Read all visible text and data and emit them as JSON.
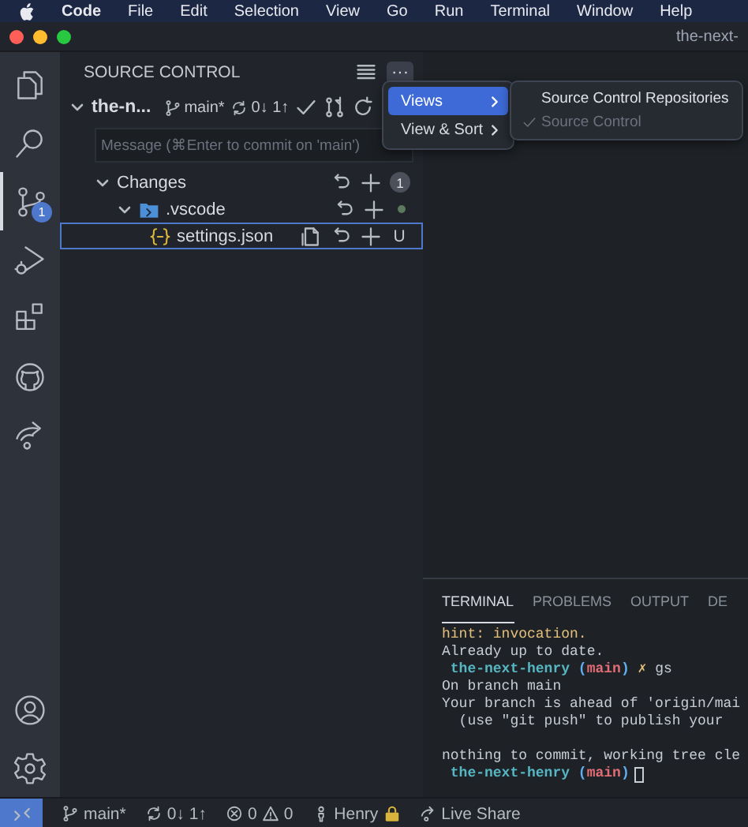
{
  "menu_bar": {
    "items": [
      {
        "label": "Code",
        "kind": "app"
      },
      {
        "label": "File",
        "kind": "menu"
      },
      {
        "label": "Edit",
        "kind": "menu"
      },
      {
        "label": "Selection",
        "kind": "menu"
      },
      {
        "label": "View",
        "kind": "menu"
      },
      {
        "label": "Go",
        "kind": "menu"
      },
      {
        "label": "Run",
        "kind": "menu"
      },
      {
        "label": "Terminal",
        "kind": "menu"
      },
      {
        "label": "Window",
        "kind": "menu"
      },
      {
        "label": "Help",
        "kind": "menu"
      }
    ]
  },
  "window": {
    "title": "the-next-"
  },
  "activity_bar": {
    "items": [
      {
        "kind": "files",
        "selected": false
      },
      {
        "kind": "search",
        "selected": false
      },
      {
        "kind": "source_control",
        "selected": true,
        "badge": "1"
      },
      {
        "kind": "run",
        "selected": false
      },
      {
        "kind": "extensions",
        "selected": false
      },
      {
        "kind": "github",
        "selected": false
      },
      {
        "kind": "live_share",
        "selected": false
      }
    ],
    "bottom_items": [
      {
        "kind": "accounts",
        "selected": false
      },
      {
        "kind": "settings",
        "selected": false
      }
    ]
  },
  "sidebar": {
    "title": "SOURCE CONTROL",
    "more": "···",
    "repository": {
      "name": "the-n...",
      "expanded": true,
      "branch": "main*",
      "sync": "0↓ 1↑"
    },
    "message": {
      "placeholder": "Message (⌘Enter to commit on 'main')"
    },
    "changes": {
      "label": "Changes",
      "count": "1",
      "expanded": true,
      "children": [
        {
          "kind": "folder",
          "name": ".vscode",
          "expanded": true,
          "selected": false,
          "children": [
            {
              "kind": "file",
              "name": "settings.json",
              "status": "U",
              "selected": true
            }
          ]
        }
      ]
    }
  },
  "context_menu": {
    "items": [
      {
        "label": "Views",
        "selected": true
      },
      {
        "label": "View & Sort",
        "selected": false
      }
    ],
    "submenu": {
      "items": [
        {
          "label": "Source Control Repositories",
          "checked": false,
          "disabled": false
        },
        {
          "label": "Source Control",
          "checked": true,
          "disabled": true
        }
      ]
    }
  },
  "panel": {
    "tabs": [
      {
        "label": "TERMINAL",
        "selected": true
      },
      {
        "label": "PROBLEMS",
        "selected": false
      },
      {
        "label": "OUTPUT",
        "selected": false
      },
      {
        "label": "DE",
        "selected": false
      }
    ],
    "lines": [
      {
        "segments": [
          {
            "kind": "hint",
            "text": "hint: invocation."
          }
        ]
      },
      {
        "segments": [
          {
            "kind": "text",
            "text": "Already up to date."
          }
        ]
      },
      {
        "segments": [
          {
            "kind": "prompt",
            "text": " the-next-henry "
          },
          {
            "kind": "paren",
            "text": "("
          },
          {
            "kind": "branch",
            "text": "main"
          },
          {
            "kind": "paren",
            "text": ")"
          },
          {
            "kind": "mark",
            "text": " ✗"
          },
          {
            "kind": "text",
            "text": " gs"
          }
        ]
      },
      {
        "segments": [
          {
            "kind": "text",
            "text": "On branch main"
          }
        ]
      },
      {
        "segments": [
          {
            "kind": "text",
            "text": "Your branch is ahead of 'origin/mai"
          }
        ]
      },
      {
        "segments": [
          {
            "kind": "text",
            "text": "  (use \"git push\" to publish your"
          }
        ]
      },
      {
        "gap_before": true,
        "segments": [
          {
            "kind": "text",
            "text": "nothing to commit, working tree cle"
          }
        ]
      },
      {
        "cursor": true,
        "segments": [
          {
            "kind": "prompt",
            "text": " the-next-henry "
          },
          {
            "kind": "paren",
            "text": "("
          },
          {
            "kind": "branch",
            "text": "main"
          },
          {
            "kind": "paren",
            "text": ")"
          }
        ]
      }
    ]
  },
  "status_bar": {
    "branch": "main*",
    "sync": "0↓ 1↑",
    "errors": "0",
    "warnings": "0",
    "user": "Henry",
    "live_share": "Live Share"
  }
}
